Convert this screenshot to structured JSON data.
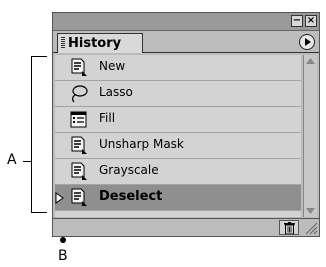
{
  "callouts": {
    "a": "A",
    "b": "B"
  },
  "palette": {
    "tab_label": "History",
    "minimize_glyph": "−",
    "close_glyph": "×",
    "items": [
      {
        "label": "New",
        "icon": "document-arrow-icon"
      },
      {
        "label": "Lasso",
        "icon": "lasso-icon"
      },
      {
        "label": "Fill",
        "icon": "fill-list-icon"
      },
      {
        "label": "Unsharp Mask",
        "icon": "document-arrow-icon"
      },
      {
        "label": "Grayscale",
        "icon": "document-arrow-icon"
      },
      {
        "label": "Deselect",
        "icon": "document-arrow-icon",
        "selected": true
      }
    ]
  }
}
